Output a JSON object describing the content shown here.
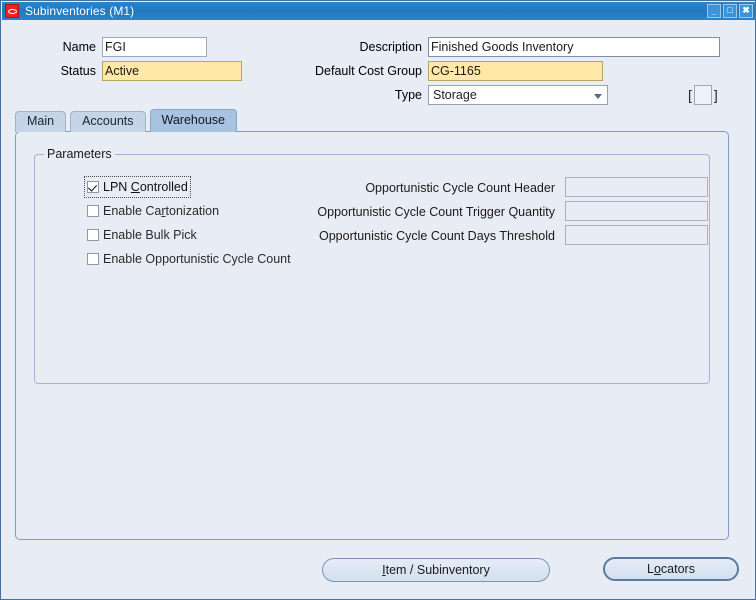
{
  "window": {
    "title": "Subinventories (M1)",
    "icon": "oracle-logo-icon",
    "controls": {
      "minimize": "_",
      "maximize": "□",
      "close": "✖"
    }
  },
  "header": {
    "name": {
      "label": "Name",
      "value": "FGI"
    },
    "status": {
      "label": "Status",
      "value": "Active"
    },
    "description": {
      "label": "Description",
      "value": "Finished Goods Inventory"
    },
    "default_cost_group": {
      "label": "Default Cost Group",
      "value": "CG-1165"
    },
    "type": {
      "label": "Type",
      "value": "Storage"
    },
    "flexfield": {
      "open_bracket": "[",
      "close_bracket": "]",
      "value": ""
    }
  },
  "tabs": [
    {
      "label": "Main",
      "active": false
    },
    {
      "label": "Accounts",
      "active": false
    },
    {
      "label": "Warehouse",
      "active": true
    }
  ],
  "warehouse_tab": {
    "parameters_group": {
      "legend": "Parameters",
      "checkboxes": [
        {
          "label_pre": "LPN ",
          "mnemonic": "C",
          "label_post": "ontrolled",
          "checked": true,
          "enabled": true,
          "focused": true
        },
        {
          "label_pre": "Enable Ca",
          "mnemonic": "r",
          "label_post": "tonization",
          "checked": false,
          "enabled": false,
          "focused": false
        },
        {
          "label_pre": "Enable Bulk Pick",
          "mnemonic": "",
          "label_post": "",
          "checked": false,
          "enabled": false,
          "focused": false
        },
        {
          "label_pre": "Enable Opportunistic Cycle Count",
          "mnemonic": "",
          "label_post": "",
          "checked": false,
          "enabled": false,
          "focused": false
        }
      ],
      "fields": [
        {
          "label": "Opportunistic Cycle Count Header",
          "value": "",
          "enabled": false
        },
        {
          "label": "Opportunistic Cycle Count Trigger Quantity",
          "value": "",
          "enabled": false
        },
        {
          "label": "Opportunistic Cycle Count Days Threshold",
          "value": "",
          "enabled": false
        }
      ]
    }
  },
  "buttons": {
    "item_subinventory": {
      "pre": "",
      "mnemonic": "I",
      "post": "tem / Subinventory",
      "default": false
    },
    "locators": {
      "pre": "L",
      "mnemonic": "o",
      "post": "cators",
      "default": true
    }
  },
  "colors": {
    "window_background": "#e8ecf4",
    "title_bar": "#2179bf",
    "required_field": "#ffe8a8",
    "active_tab": "#a8c3e0",
    "inactive_tab": "#c5d4e6",
    "panel_border": "#7d9ec4"
  }
}
